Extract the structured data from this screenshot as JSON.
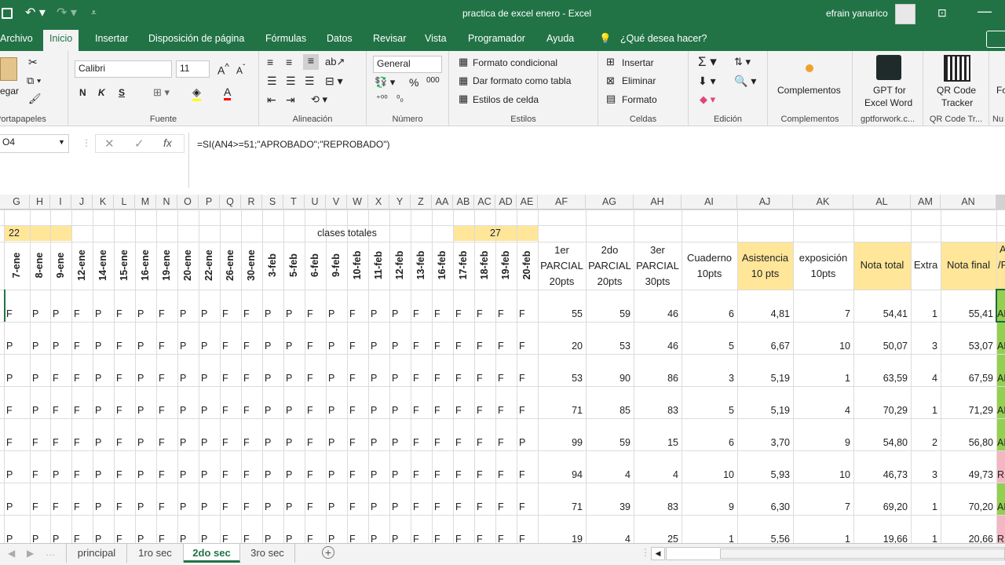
{
  "titlebar": {
    "title": "practica de excel enero  -  Excel",
    "user": "efrain yanarico"
  },
  "tabs": [
    "Archivo",
    "Inicio",
    "Insertar",
    "Disposición de página",
    "Fórmulas",
    "Datos",
    "Revisar",
    "Vista",
    "Programador",
    "Ayuda",
    "¿Qué desea hacer?"
  ],
  "ribbon": {
    "clipboard": {
      "paste": "Pegar",
      "label": "Portapapeles"
    },
    "font": {
      "name": "Calibri",
      "size": "11",
      "bold": "N",
      "italic": "K",
      "underline": "S",
      "label": "Fuente"
    },
    "alignment": {
      "label": "Alineación"
    },
    "number": {
      "format": "General",
      "percent": "%",
      "thousands": "000",
      "label": "Número"
    },
    "styles": {
      "conditional": "Formato condicional",
      "table": "Dar formato como tabla",
      "cell": "Estilos de celda",
      "label": "Estilos"
    },
    "cells": {
      "insert": "Insertar",
      "delete": "Eliminar",
      "format": "Formato",
      "label": "Celdas"
    },
    "editing": {
      "label": "Edición"
    },
    "addins": {
      "btn": "Complementos",
      "label": "Complementos"
    },
    "gpt": {
      "btn1": "GPT for",
      "btn2": "Excel Word",
      "label": "gptforwork.c..."
    },
    "qr": {
      "btn1": "QR Code",
      "btn2": "Tracker",
      "label": "QR Code Tr..."
    },
    "nu": {
      "btn": "Fo",
      "label": "Nu"
    }
  },
  "formula_bar": {
    "namebox": "O4",
    "formula": "=SI(AN4>=51;\"APROBADO\";\"REPROBADO\")"
  },
  "columns": [
    "G",
    "H",
    "I",
    "J",
    "K",
    "L",
    "M",
    "N",
    "O",
    "P",
    "Q",
    "R",
    "S",
    "T",
    "U",
    "V",
    "W",
    "X",
    "Y",
    "Z",
    "AA",
    "AB",
    "AC",
    "AD",
    "AE",
    "AF",
    "AG",
    "AH",
    "AI",
    "AJ",
    "AK",
    "AL",
    "AM",
    "AN"
  ],
  "row2": {
    "left_num": "22",
    "center": "clases totales",
    "right_num": "27"
  },
  "dates": [
    "7-ene",
    "8-ene",
    "9-ene",
    "12-ene",
    "14-ene",
    "15-ene",
    "16-ene",
    "19-ene",
    "20-ene",
    "22-ene",
    "26-ene",
    "30-ene",
    "3-feb",
    "5-feb",
    "6-feb",
    "9-feb",
    "10-feb",
    "11-feb",
    "12-feb",
    "13-feb",
    "16-feb",
    "17-feb",
    "18-feb",
    "19-feb",
    "20-feb"
  ],
  "headers": {
    "af": [
      "1er",
      "PARCIAL",
      "20pts"
    ],
    "ag": [
      "2do",
      "PARCIAL",
      "20pts"
    ],
    "ah": [
      "3er",
      "PARCIAL",
      "30pts"
    ],
    "ai": [
      "Cuaderno",
      "10pts"
    ],
    "aj": [
      "Asistencia",
      "10 pts"
    ],
    "ak": [
      "exposición",
      "10pts"
    ],
    "al": "Nota total",
    "am": "Extra",
    "an": "Nota final",
    "ao": [
      "Al",
      "/R"
    ]
  },
  "rows": [
    {
      "att": [
        "F",
        "P",
        "P",
        "F",
        "P",
        "F",
        "P",
        "F",
        "P",
        "P",
        "F",
        "F",
        "P",
        "P",
        "F",
        "P",
        "F",
        "P",
        "P",
        "F",
        "F",
        "F",
        "F",
        "F",
        "F"
      ],
      "p1": "55",
      "p2": "59",
      "p3": "46",
      "cuad": "6",
      "asis": "4,81",
      "exp": "7",
      "total": "54,41",
      "extra": "1",
      "final": "55,41",
      "status": "AP"
    },
    {
      "att": [
        "P",
        "P",
        "P",
        "F",
        "P",
        "F",
        "P",
        "F",
        "P",
        "P",
        "F",
        "F",
        "P",
        "P",
        "F",
        "P",
        "F",
        "P",
        "P",
        "F",
        "F",
        "F",
        "F",
        "F",
        "F"
      ],
      "p1": "20",
      "p2": "53",
      "p3": "46",
      "cuad": "5",
      "asis": "6,67",
      "exp": "10",
      "total": "50,07",
      "extra": "3",
      "final": "53,07",
      "status": "AP"
    },
    {
      "att": [
        "P",
        "P",
        "F",
        "F",
        "P",
        "F",
        "P",
        "F",
        "P",
        "P",
        "F",
        "F",
        "P",
        "P",
        "F",
        "P",
        "F",
        "P",
        "P",
        "F",
        "F",
        "F",
        "F",
        "F",
        "F"
      ],
      "p1": "53",
      "p2": "90",
      "p3": "86",
      "cuad": "3",
      "asis": "5,19",
      "exp": "1",
      "total": "63,59",
      "extra": "4",
      "final": "67,59",
      "status": "AP"
    },
    {
      "att": [
        "F",
        "P",
        "F",
        "F",
        "P",
        "F",
        "P",
        "F",
        "P",
        "P",
        "F",
        "F",
        "P",
        "P",
        "F",
        "P",
        "F",
        "P",
        "P",
        "F",
        "F",
        "F",
        "F",
        "F",
        "F"
      ],
      "p1": "71",
      "p2": "85",
      "p3": "83",
      "cuad": "5",
      "asis": "5,19",
      "exp": "4",
      "total": "70,29",
      "extra": "1",
      "final": "71,29",
      "status": "AP"
    },
    {
      "att": [
        "F",
        "F",
        "F",
        "F",
        "P",
        "F",
        "P",
        "F",
        "P",
        "P",
        "F",
        "F",
        "P",
        "P",
        "F",
        "P",
        "F",
        "P",
        "P",
        "F",
        "F",
        "F",
        "F",
        "F",
        "P"
      ],
      "p1": "99",
      "p2": "59",
      "p3": "15",
      "cuad": "6",
      "asis": "3,70",
      "exp": "9",
      "total": "54,80",
      "extra": "2",
      "final": "56,80",
      "status": "AP"
    },
    {
      "att": [
        "P",
        "F",
        "P",
        "F",
        "P",
        "F",
        "P",
        "F",
        "P",
        "P",
        "F",
        "F",
        "P",
        "P",
        "F",
        "P",
        "F",
        "P",
        "P",
        "F",
        "F",
        "F",
        "F",
        "F",
        "F"
      ],
      "p1": "94",
      "p2": "4",
      "p3": "4",
      "cuad": "10",
      "asis": "5,93",
      "exp": "10",
      "total": "46,73",
      "extra": "3",
      "final": "49,73",
      "status": "RE"
    },
    {
      "att": [
        "P",
        "F",
        "F",
        "F",
        "P",
        "F",
        "P",
        "F",
        "P",
        "P",
        "F",
        "F",
        "P",
        "P",
        "F",
        "P",
        "F",
        "P",
        "P",
        "F",
        "F",
        "F",
        "F",
        "F",
        "F"
      ],
      "p1": "71",
      "p2": "39",
      "p3": "83",
      "cuad": "9",
      "asis": "6,30",
      "exp": "7",
      "total": "69,20",
      "extra": "1",
      "final": "70,20",
      "status": "AP"
    },
    {
      "att": [
        "P",
        "P",
        "P",
        "F",
        "P",
        "F",
        "P",
        "F",
        "P",
        "P",
        "F",
        "F",
        "P",
        "P",
        "F",
        "P",
        "F",
        "P",
        "P",
        "F",
        "F",
        "F",
        "F",
        "F",
        "F"
      ],
      "p1": "19",
      "p2": "4",
      "p3": "25",
      "cuad": "1",
      "asis": "5,56",
      "exp": "1",
      "total": "19,66",
      "extra": "1",
      "final": "20,66",
      "status": "RE"
    }
  ],
  "sheets": [
    "principal",
    "1ro sec",
    "2do sec",
    "3ro sec"
  ],
  "colors": {
    "excel_green": "#217346",
    "yellow": "#ffe699",
    "pass": "#92d050",
    "fail": "#f4b6c2"
  }
}
